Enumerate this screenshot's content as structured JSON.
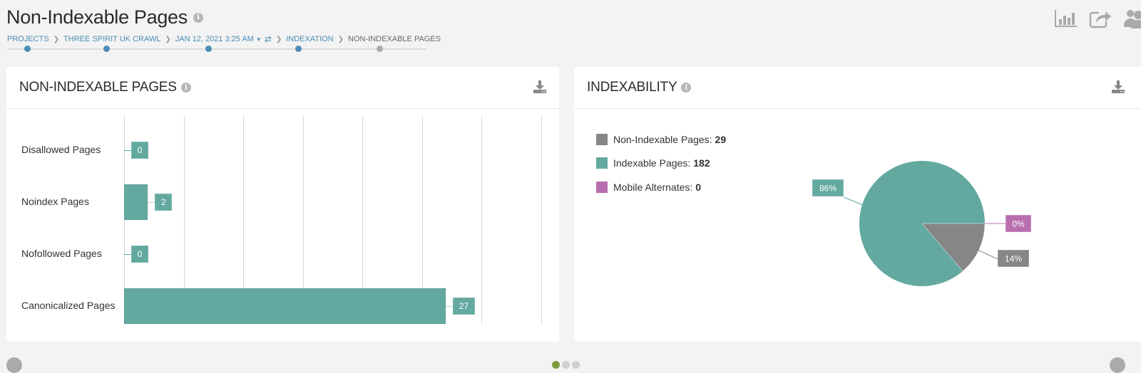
{
  "page": {
    "title": "Non-Indexable Pages",
    "info_icon": "info-icon"
  },
  "breadcrumb": [
    {
      "label": "PROJECTS",
      "link": true
    },
    {
      "label": "THREE SPIRIT UK CRAWL",
      "link": true
    },
    {
      "label": "JAN 12, 2021 3:25 AM",
      "link": true,
      "dropdown": true,
      "swap_icon": "swap-arrows-icon"
    },
    {
      "label": "INDEXATION",
      "link": true
    },
    {
      "label": "NON-INDEXABLE PAGES",
      "link": false
    }
  ],
  "steps": {
    "count": 5,
    "current_index": 4
  },
  "top_icons": [
    "bar-chart-icon",
    "share-icon",
    "users-icon"
  ],
  "colors": {
    "teal": "#64a9a0",
    "gray": "#868686",
    "magenta": "#b86faf",
    "link_blue": "#4b8db5",
    "pager_active": "#7d9a3a"
  },
  "cards": {
    "left": {
      "title": "NON-INDEXABLE PAGES",
      "download_icon": "download-icon"
    },
    "right": {
      "title": "INDEXABILITY",
      "download_icon": "download-icon"
    }
  },
  "chart_data": [
    {
      "type": "bar",
      "orientation": "horizontal",
      "title": "NON-INDEXABLE PAGES",
      "categories": [
        "Disallowed Pages",
        "Noindex Pages",
        "Nofollowed Pages",
        "Canonicalized Pages"
      ],
      "values": [
        0,
        2,
        0,
        27
      ],
      "data_labels": [
        "0",
        "2",
        "0",
        "27"
      ],
      "xlim": [
        0,
        35
      ],
      "grid_step": 5,
      "grid": true,
      "xlabel": "",
      "ylabel": ""
    },
    {
      "type": "pie",
      "title": "INDEXABILITY",
      "legend": [
        {
          "label": "Non-Indexable Pages:",
          "value": "29",
          "color": "#868686"
        },
        {
          "label": "Indexable Pages:",
          "value": "182",
          "color": "#64a9a0"
        },
        {
          "label": "Mobile Alternates:",
          "value": "0",
          "color": "#b86faf"
        }
      ],
      "legend_position": "top-left",
      "slices": [
        {
          "name": "Indexable Pages",
          "value": 182,
          "percent_label": "86%",
          "color": "#64a9a0"
        },
        {
          "name": "Non-Indexable Pages",
          "value": 29,
          "percent_label": "14%",
          "color": "#868686"
        },
        {
          "name": "Mobile Alternates",
          "value": 0,
          "percent_label": "0%",
          "color": "#b86faf"
        }
      ]
    }
  ],
  "pager": {
    "count": 3,
    "active_index": 0
  }
}
